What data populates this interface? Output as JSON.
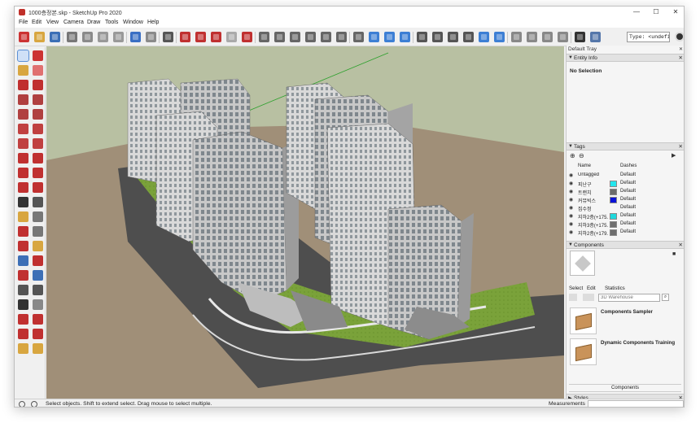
{
  "window": {
    "title": "1000층정본.skp - SketchUp Pro 2020",
    "controls": {
      "minimize": "—",
      "maximize": "☐",
      "close": "✕"
    }
  },
  "menu": [
    "File",
    "Edit",
    "View",
    "Camera",
    "Draw",
    "Tools",
    "Window",
    "Help"
  ],
  "toolbar": {
    "measurement_type_value": "Type: <undefin",
    "top_buttons": [
      {
        "name": "getting-started-icon",
        "color": "#c33"
      },
      {
        "name": "open-icon",
        "color": "#d8a640"
      },
      {
        "name": "save-icon",
        "color": "#3b6fb6"
      },
      {
        "name": "cut-icon",
        "color": "#777"
      },
      {
        "name": "copy-icon",
        "color": "#8a8a8a"
      },
      {
        "name": "paste-icon",
        "color": "#999"
      },
      {
        "name": "erase-icon",
        "color": "#999"
      },
      {
        "name": "undo-icon",
        "color": "#3a6fc4"
      },
      {
        "name": "redo-icon",
        "color": "#8a8a8a"
      },
      {
        "name": "print-icon",
        "color": "#555"
      },
      {
        "name": "model-info-icon",
        "color": "#c03030"
      },
      {
        "name": "warehouse-icon",
        "color": "#c03030"
      },
      {
        "name": "share-model-icon",
        "color": "#c03030"
      },
      {
        "name": "share-component-icon",
        "color": "#aaaaaa"
      },
      {
        "name": "extension-warehouse-icon",
        "color": "#c03030"
      },
      {
        "name": "iso-view-icon",
        "color": "#666"
      },
      {
        "name": "top-view-icon",
        "color": "#666"
      },
      {
        "name": "front-view-icon",
        "color": "#666"
      },
      {
        "name": "right-view-icon",
        "color": "#666"
      },
      {
        "name": "back-view-icon",
        "color": "#666"
      },
      {
        "name": "left-view-icon",
        "color": "#666"
      },
      {
        "name": "xray-icon",
        "color": "#666"
      },
      {
        "name": "back-edges-icon",
        "color": "#3d7fd4"
      },
      {
        "name": "wireframe-icon",
        "color": "#3d7fd4"
      },
      {
        "name": "hidden-line-icon",
        "color": "#3d7fd4"
      },
      {
        "name": "shaded-icon",
        "color": "#555"
      },
      {
        "name": "shaded-textures-icon",
        "color": "#555"
      },
      {
        "name": "monochrome-icon",
        "color": "#555"
      },
      {
        "name": "section-plane-icon",
        "color": "#555"
      },
      {
        "name": "section-cuts-icon",
        "color": "#3d7fd4"
      },
      {
        "name": "section-fill-icon",
        "color": "#3d7fd4"
      },
      {
        "name": "sandbox-icon",
        "color": "#888"
      },
      {
        "name": "smoove-icon",
        "color": "#888"
      },
      {
        "name": "stamp-icon",
        "color": "#888"
      },
      {
        "name": "drape-icon",
        "color": "#888"
      },
      {
        "name": "add-detail-icon",
        "color": "#333"
      },
      {
        "name": "flip-edge-icon",
        "color": "#5577aa"
      }
    ]
  },
  "left_tools": [
    {
      "name": "select-icon",
      "color": "#333",
      "active": true
    },
    {
      "name": "make-component-icon",
      "color": "#c33"
    },
    {
      "name": "paint-bucket-icon",
      "color": "#d8a640"
    },
    {
      "name": "eraser-icon",
      "color": "#e07070"
    },
    {
      "name": "line-icon",
      "color": "#c03030"
    },
    {
      "name": "freehand-icon",
      "color": "#c03030"
    },
    {
      "name": "rectangle-icon",
      "color": "#b04040"
    },
    {
      "name": "rotated-rectangle-icon",
      "color": "#b04040"
    },
    {
      "name": "circle-icon",
      "color": "#b04040"
    },
    {
      "name": "polygon-icon",
      "color": "#b04040"
    },
    {
      "name": "arc-icon",
      "color": "#c04040"
    },
    {
      "name": "two-point-arc-icon",
      "color": "#c04040"
    },
    {
      "name": "three-point-arc-icon",
      "color": "#c04040"
    },
    {
      "name": "pie-icon",
      "color": "#c04040"
    },
    {
      "name": "move-icon",
      "color": "#c03030"
    },
    {
      "name": "push-pull-icon",
      "color": "#c03030"
    },
    {
      "name": "rotate-icon",
      "color": "#c03030"
    },
    {
      "name": "follow-me-icon",
      "color": "#c03030"
    },
    {
      "name": "scale-icon",
      "color": "#c03030"
    },
    {
      "name": "offset-icon",
      "color": "#c03030"
    },
    {
      "name": "tape-measure-icon",
      "color": "#333"
    },
    {
      "name": "dimension-icon",
      "color": "#555"
    },
    {
      "name": "protractor-icon",
      "color": "#d8a640"
    },
    {
      "name": "text-icon",
      "color": "#777"
    },
    {
      "name": "axes-icon",
      "color": "#c03030"
    },
    {
      "name": "3d-text-icon",
      "color": "#777"
    },
    {
      "name": "orbit-icon",
      "color": "#c03030"
    },
    {
      "name": "pan-icon",
      "color": "#d8a640"
    },
    {
      "name": "zoom-icon",
      "color": "#3d6fb6"
    },
    {
      "name": "zoom-window-icon",
      "color": "#c03030"
    },
    {
      "name": "zoom-extents-icon",
      "color": "#c03030"
    },
    {
      "name": "previous-view-icon",
      "color": "#3d6fb6"
    },
    {
      "name": "position-camera-icon",
      "color": "#555"
    },
    {
      "name": "look-around-icon",
      "color": "#555"
    },
    {
      "name": "walk-icon",
      "color": "#333"
    },
    {
      "name": "section-plane-tool-icon",
      "color": "#888"
    },
    {
      "name": "model-info-tool-icon",
      "color": "#c03030"
    },
    {
      "name": "warehouse-tool-icon",
      "color": "#c03030"
    },
    {
      "name": "extension-manager-icon",
      "color": "#c03030"
    },
    {
      "name": "share-tool-icon",
      "color": "#c03030"
    },
    {
      "name": "ruby-console-icon",
      "color": "#d8a640"
    },
    {
      "name": "extension-warehouse-tool-icon",
      "color": "#d8a640"
    }
  ],
  "tray": {
    "title": "Default Tray",
    "entity_info": {
      "header": "Entity Info",
      "selection": "No Selection"
    },
    "tags": {
      "header": "Tags",
      "col_name": "Name",
      "col_dashes": "Dashes",
      "rows": [
        {
          "name": "Untagged",
          "color": "",
          "dashes": "Default"
        },
        {
          "name": "피난구",
          "color": "#23e6ee",
          "dashes": "Default"
        },
        {
          "name": "트랜치",
          "color": "#6c6c6c",
          "dashes": "Default"
        },
        {
          "name": "커뮤빅스",
          "color": "#0a12d8",
          "dashes": "Default"
        },
        {
          "name": "집수정",
          "color": "",
          "dashes": "Default"
        },
        {
          "name": "지하2층(+175.",
          "color": "#1fd8dc",
          "dashes": "Default"
        },
        {
          "name": "지하3층(+175.",
          "color": "#6e6e6e",
          "dashes": "Default"
        },
        {
          "name": "지하2층(+179.",
          "color": "#6e6e6e",
          "dashes": "Default"
        }
      ]
    },
    "components": {
      "header": "Components",
      "tabs": [
        "Select",
        "Edit",
        "Statistics"
      ],
      "search_placeholder": "3D Warehouse",
      "items": [
        {
          "name": "Components Sampler"
        },
        {
          "name": "Dynamic Components Training"
        }
      ],
      "footer": "Components"
    },
    "styles": {
      "header": "Styles"
    }
  },
  "status": {
    "message": "Select objects. Shift to extend select. Drag mouse to select multiple.",
    "measurements_label": "Measurements"
  }
}
